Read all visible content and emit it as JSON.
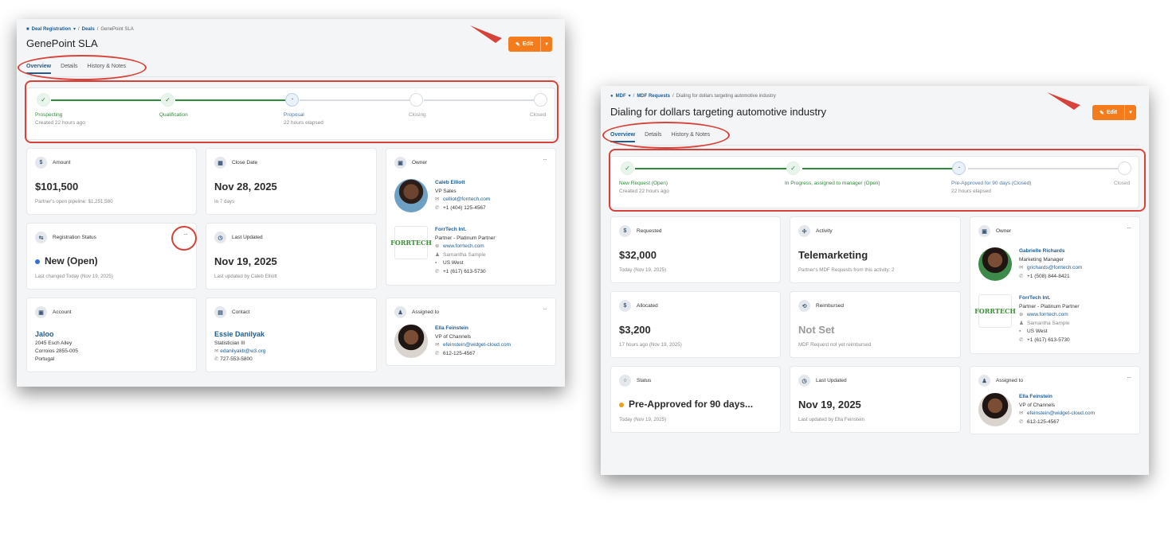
{
  "left": {
    "breadcrumb": {
      "app": "Deal Registration",
      "section": "Deals",
      "current": "GenePoint SLA"
    },
    "title": "GenePoint SLA",
    "edit_label": "Edit",
    "tabs": [
      "Overview",
      "Details",
      "History & Notes"
    ],
    "stages": [
      {
        "label": "Prospecting",
        "sub": "Created 22 hours ago",
        "state": "done"
      },
      {
        "label": "Qualification",
        "sub": "",
        "state": "done"
      },
      {
        "label": "Proposal",
        "sub": "22 hours elapsed",
        "state": "current"
      },
      {
        "label": "Closing",
        "sub": "",
        "state": "todo"
      },
      {
        "label": "Closed",
        "sub": "",
        "state": "todo"
      }
    ],
    "amount": {
      "label": "Amount",
      "value": "$101,500",
      "sub": "Partner's open pipeline: $1,251,580"
    },
    "close_date": {
      "label": "Close Date",
      "value": "Nov 28, 2025",
      "sub": "In 7 days"
    },
    "reg_status": {
      "label": "Registration Status",
      "value": "New (Open)",
      "sub": "Last changed Today (Nov 19, 2025)",
      "dot_color": "#2f6fd6"
    },
    "last_updated": {
      "label": "Last Updated",
      "value": "Nov 19, 2025",
      "sub": "Last updated by Caleb Elliott"
    },
    "account": {
      "label": "Account",
      "name": "Jaloo",
      "line1": "2045 Esch Alley",
      "line2": "Corroios 2855-005",
      "line3": "Portugal"
    },
    "contact": {
      "label": "Contact",
      "name": "Essie Danilyak",
      "title": "Statistician III",
      "email": "edanilyakb@w3.org",
      "phone": "727-553-5800"
    },
    "owner": {
      "label": "Owner",
      "name": "Caleb Elliott",
      "title": "VP Sales",
      "email": "celliot@forrtech.com",
      "phone": "+1 (404) 125-4567",
      "company": "ForrTech Int.",
      "tier": "Partner - Platinum Partner",
      "web": "www.forrtech.com",
      "contact": "Samantha Sample",
      "region": "US West",
      "cphone": "+1 (617) 613-5730",
      "logo": "FORRTECH"
    },
    "assigned": {
      "label": "Assigned to",
      "name": "Ella Feinstein",
      "title": "VP of Channels",
      "email": "efeinstein@widget-cloud.com",
      "phone": "612-125-4567"
    }
  },
  "right": {
    "breadcrumb": {
      "app": "MDF",
      "section": "MDF Requests",
      "current": "Dialing for dollars targeting automotive industry"
    },
    "title": "Dialing for dollars targeting automotive industry",
    "edit_label": "Edit",
    "tabs": [
      "Overview",
      "Details",
      "History & Notes"
    ],
    "stages": [
      {
        "label": "New Request (Open)",
        "sub": "Created 22 hours ago",
        "state": "done"
      },
      {
        "label": "In Progress, assigned to manager (Open)",
        "sub": "",
        "state": "done"
      },
      {
        "label": "Pre-Approved for 90 days (Closed)",
        "sub": "22 hours elapsed",
        "state": "current"
      },
      {
        "label": "Closed",
        "sub": "",
        "state": "todo"
      }
    ],
    "requested": {
      "label": "Requested",
      "value": "$32,000",
      "sub": "Today (Nov 19, 2025)"
    },
    "activity": {
      "label": "Activity",
      "value": "Telemarketing",
      "sub": "Partner's MDF Requests from this activity: 2"
    },
    "allocated": {
      "label": "Allocated",
      "value": "$3,200",
      "sub": "17 hours ago (Nov 19, 2025)"
    },
    "reimbursed": {
      "label": "Reimbursed",
      "value": "Not Set",
      "sub": "MDF Request not yet reimbursed"
    },
    "status": {
      "label": "Status",
      "value": "Pre-Approved for 90 days...",
      "sub": "Today (Nov 19, 2025)",
      "dot_color": "#f0a020"
    },
    "last_updated": {
      "label": "Last Updated",
      "value": "Nov 19, 2025",
      "sub": "Last updated by Ella Feinstein"
    },
    "owner": {
      "label": "Owner",
      "name": "Gabrielle Richards",
      "title": "Marketing Manager",
      "email": "grichards@forrtech.com",
      "phone": "+1 (508) 844-8421",
      "company": "ForrTech Int.",
      "tier": "Partner - Platinum Partner",
      "web": "www.forrtech.com",
      "contact": "Samantha Sample",
      "region": "US West",
      "cphone": "+1 (617) 613-5730",
      "logo": "FORRTECH"
    },
    "assigned": {
      "label": "Assigned to",
      "name": "Ella Feinstein",
      "title": "VP of Channels",
      "email": "efeinstein@widget-cloud.com",
      "phone": "612-125-4567"
    }
  },
  "colors": {
    "accent": "#f47c1c",
    "link": "#1e5c92",
    "success": "#2e8b3c",
    "annotation": "#d7433a"
  },
  "icons": [
    "home-icon",
    "pencil-icon",
    "check-icon",
    "clock-icon",
    "dollar-icon",
    "calendar-icon",
    "more-icon",
    "mail-icon",
    "phone-icon",
    "globe-icon",
    "user-icon",
    "building-icon",
    "arrow-icon"
  ]
}
